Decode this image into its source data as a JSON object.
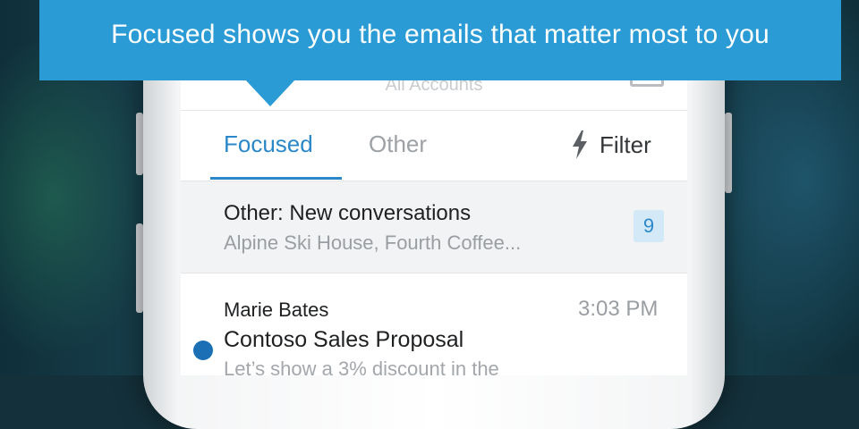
{
  "tooltip": {
    "text": "Focused shows you the emails that matter most to you"
  },
  "header": {
    "title": "All Accounts",
    "menu_icon": "hamburger-icon",
    "compose_icon": "compose-icon"
  },
  "tabs": {
    "focused_label": "Focused",
    "other_label": "Other",
    "filter_label": "Filter",
    "filter_icon": "lightning-bolt-icon",
    "active": "Focused"
  },
  "other_summary": {
    "title": "Other: New conversations",
    "preview": "Alpine Ski House, Fourth Coffee...",
    "count": "9"
  },
  "message": {
    "sender": "Marie Bates",
    "time": "3:03 PM",
    "subject": "Contoso Sales Proposal",
    "snippet": "Let’s show a 3% discount in the",
    "unread": true
  },
  "colors": {
    "accent": "#2b88c8",
    "callout": "#2b9bd6",
    "unread_dot": "#1a6fb5"
  }
}
